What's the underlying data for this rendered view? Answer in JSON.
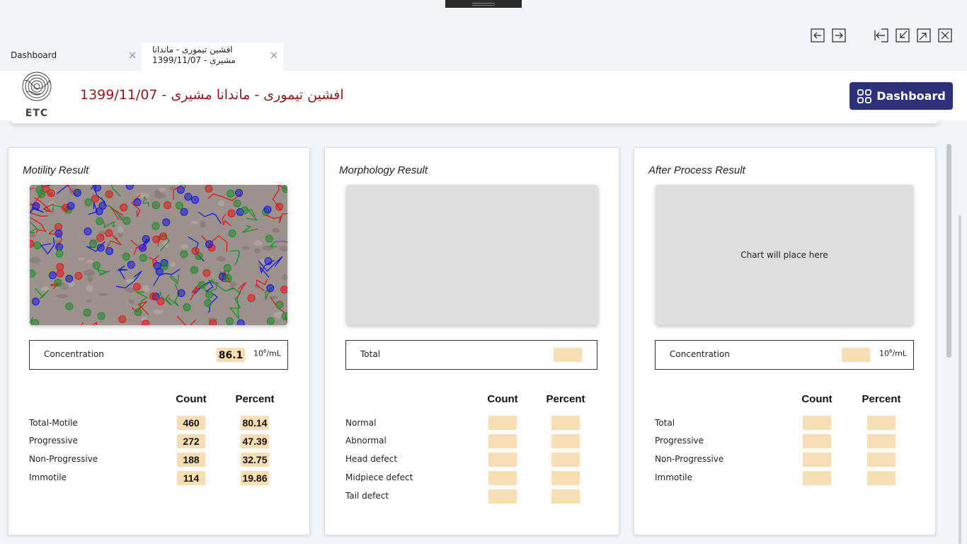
{
  "tabs": [
    {
      "label": "Dashboard"
    },
    {
      "label": "افشین تیموری - ماندانا مشیری - 1399/11/07"
    }
  ],
  "header": {
    "logo_text": "ETC",
    "title": "افشین تیموری - ماندانا مشیری - 1399/11/07",
    "dashboard_button": "Dashboard"
  },
  "colors": {
    "accent": "#2d3177",
    "title": "#8b1a1a",
    "value_fill": "#f8deb4"
  },
  "motility": {
    "title": "Motility Result",
    "concentration_label": "Concentration",
    "concentration_value": "86.1",
    "unit_base": "10",
    "unit_exp": "6",
    "unit_tail": "/mL",
    "col_count": "Count",
    "col_percent": "Percent",
    "rows": [
      {
        "label": "Total-Motile",
        "count": "460",
        "percent": "80.14"
      },
      {
        "label": "Progressive",
        "count": "272",
        "percent": "47.39"
      },
      {
        "label": "Non-Progressive",
        "count": "188",
        "percent": "32.75"
      },
      {
        "label": "Immotile",
        "count": "114",
        "percent": "19.86"
      }
    ]
  },
  "morphology": {
    "title": "Morphology Result",
    "total_label": "Total",
    "total_value": "",
    "col_count": "Count",
    "col_percent": "Percent",
    "rows": [
      {
        "label": "Normal",
        "count": "",
        "percent": ""
      },
      {
        "label": "Abnormal",
        "count": "",
        "percent": ""
      },
      {
        "label": "Head defect",
        "count": "",
        "percent": ""
      },
      {
        "label": "Midpiece defect",
        "count": "",
        "percent": ""
      },
      {
        "label": "Tail defect",
        "count": "",
        "percent": ""
      }
    ]
  },
  "after_process": {
    "title": "After Process Result",
    "placeholder": "Chart will place here",
    "concentration_label": "Concentration",
    "concentration_value": "",
    "unit_base": "10",
    "unit_exp": "6",
    "unit_tail": "/mL",
    "col_count": "Count",
    "col_percent": "Percent",
    "rows": [
      {
        "label": "Total",
        "count": "",
        "percent": ""
      },
      {
        "label": "Progressive",
        "count": "",
        "percent": ""
      },
      {
        "label": "Non-Progressive",
        "count": "",
        "percent": ""
      },
      {
        "label": "Immotile",
        "count": "",
        "percent": ""
      }
    ]
  }
}
